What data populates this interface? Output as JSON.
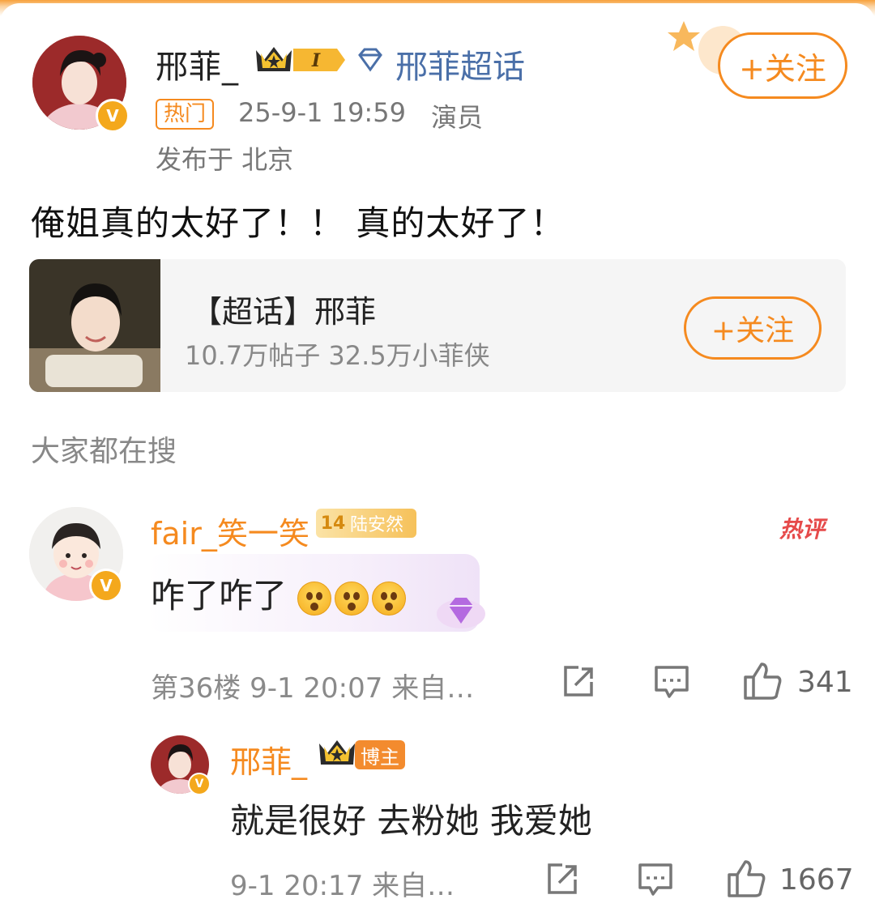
{
  "post": {
    "author": "邢菲_",
    "vip_level": "I",
    "topic_link": "邢菲超话",
    "hot_tag": "热门",
    "timestamp": "25-9-1 19:59",
    "role": "演员",
    "location": "发布于 北京",
    "follow_label": "+关注",
    "body": "俺姐真的太好了！！ 真的太好了！",
    "verified_mark": "V"
  },
  "topic_card": {
    "title": "【超话】邢菲",
    "stats": "10.7万帖子 32.5万小菲侠",
    "follow_label": "+关注"
  },
  "search_section": {
    "title": "大家都在搜"
  },
  "comment": {
    "author": "fair_笑一笑",
    "fan_level": "14",
    "fan_group": "陆安然",
    "hot_tag": "热评",
    "text": "咋了咋了",
    "emoji_count": 3,
    "floor_meta": "第36楼 9-1 20:07 来自…",
    "likes": "341"
  },
  "reply": {
    "author": "邢菲_",
    "badge": "博主",
    "text": "就是很好 去粉她 我爱她",
    "meta": "9-1 20:17 来自…",
    "likes": "1667"
  },
  "colors": {
    "accent": "#f58a1f",
    "link": "#4a6fa8",
    "hot_red": "#e64a4a"
  }
}
